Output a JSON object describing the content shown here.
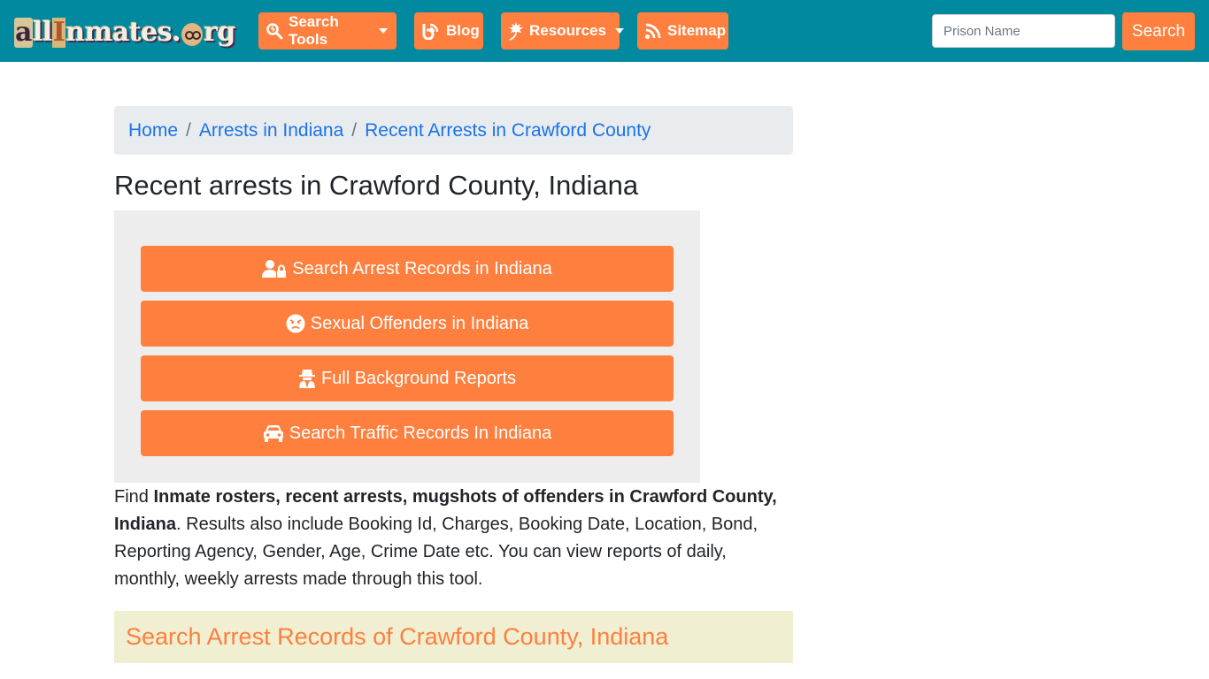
{
  "colors": {
    "navbar_bg": "#00899f",
    "accent": "#fe7f3e",
    "link": "#1a73e8",
    "breadcrumb_bg": "#e9ecef",
    "button_box_bg": "#ededed",
    "section_bg": "#f0efd2"
  },
  "navbar": {
    "logo": {
      "parts": [
        "a",
        "ll",
        "I",
        "nmates.",
        "o",
        "rg"
      ],
      "alt": "allInmates.org"
    },
    "items": [
      {
        "label": "Search Tools",
        "icon": "search-icon",
        "dropdown": true
      },
      {
        "label": "Blog",
        "icon": "blogger-icon",
        "dropdown": false
      },
      {
        "label": "Resources",
        "icon": "leaf-icon",
        "dropdown": true
      },
      {
        "label": "Sitemap",
        "icon": "rss-icon",
        "dropdown": false
      }
    ],
    "search": {
      "placeholder": "Prison Name",
      "value": "",
      "button_label": "Search"
    }
  },
  "breadcrumb": [
    {
      "label": "Home"
    },
    {
      "label": "Arrests in Indiana"
    },
    {
      "label": "Recent Arrests in Crawford County"
    }
  ],
  "breadcrumb_separator": "/",
  "page_title": "Recent arrests in Crawford County, Indiana",
  "action_buttons": [
    {
      "label": "Search Arrest Records in Indiana",
      "icon": "user-lock-icon"
    },
    {
      "label": "Sexual Offenders in Indiana",
      "icon": "angry-face-icon"
    },
    {
      "label": "Full Background Reports",
      "icon": "user-secret-icon"
    },
    {
      "label": "Search Traffic Records In Indiana",
      "icon": "car-icon"
    }
  ],
  "intro": {
    "prefix": "Find ",
    "bold": "Inmate rosters, recent arrests, mugshots of offenders in Crawford County, Indiana",
    "suffix": ". Results also include Booking Id, Charges, Booking Date, Location, Bond, Reporting Agency, Gender, Age, Crime Date etc. You can view reports of daily, monthly, weekly arrests made through this tool."
  },
  "section_heading": "Search Arrest Records of Crawford County, Indiana"
}
